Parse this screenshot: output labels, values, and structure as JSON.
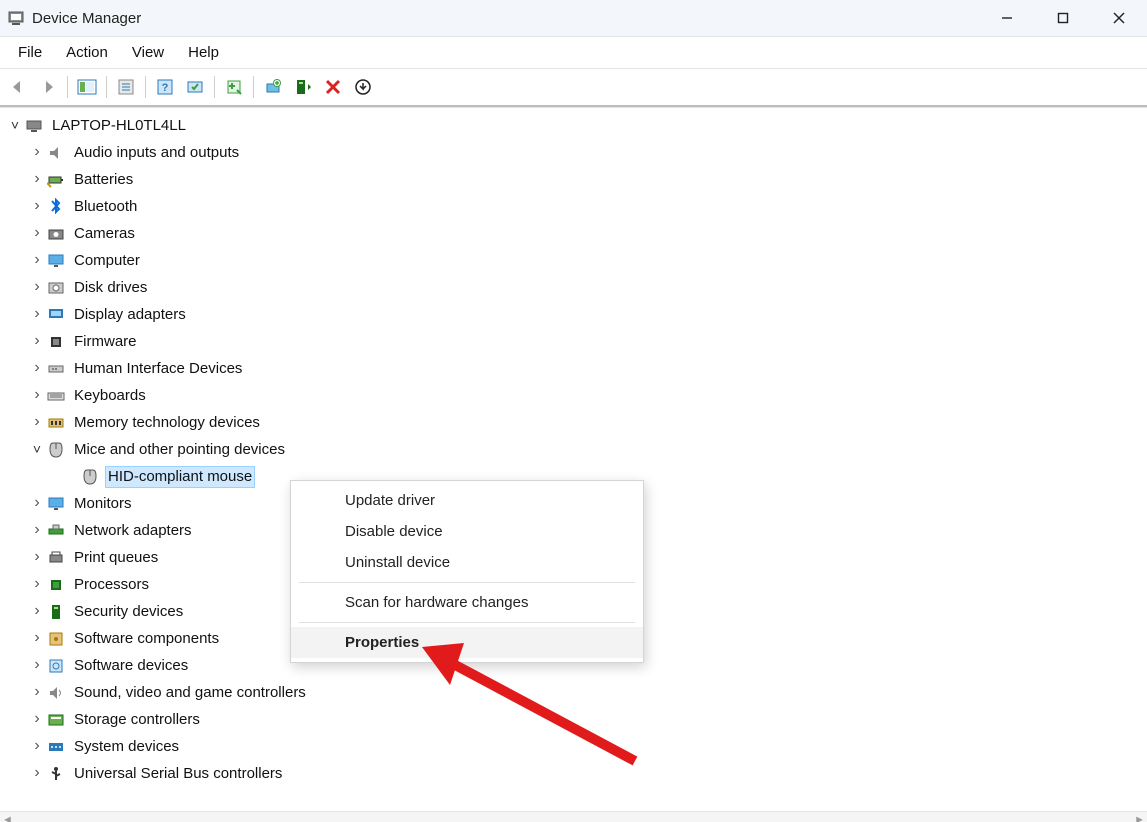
{
  "window": {
    "title": "Device Manager"
  },
  "menu": {
    "file": "File",
    "action": "Action",
    "view": "View",
    "help": "Help"
  },
  "toolbar_icons": {
    "back": "back-arrow",
    "forward": "forward-arrow",
    "show_hide": "show-hide-console-tree",
    "properties": "properties",
    "help": "help",
    "scan": "scan-for-hardware-changes",
    "add_legacy": "add-legacy-hardware",
    "update": "update-driver",
    "uninstall": "uninstall-device",
    "disable": "disable-device",
    "remove": "remove",
    "action2": "action"
  },
  "tree": {
    "root": "LAPTOP-HL0TL4LL",
    "categories": [
      {
        "label": "Audio inputs and outputs",
        "expanded": false,
        "icon": "speaker"
      },
      {
        "label": "Batteries",
        "expanded": false,
        "icon": "battery"
      },
      {
        "label": "Bluetooth",
        "expanded": false,
        "icon": "bluetooth"
      },
      {
        "label": "Cameras",
        "expanded": false,
        "icon": "camera"
      },
      {
        "label": "Computer",
        "expanded": false,
        "icon": "monitor"
      },
      {
        "label": "Disk drives",
        "expanded": false,
        "icon": "disk"
      },
      {
        "label": "Display adapters",
        "expanded": false,
        "icon": "display"
      },
      {
        "label": "Firmware",
        "expanded": false,
        "icon": "chip"
      },
      {
        "label": "Human Interface Devices",
        "expanded": false,
        "icon": "hid"
      },
      {
        "label": "Keyboards",
        "expanded": false,
        "icon": "keyboard"
      },
      {
        "label": "Memory technology devices",
        "expanded": false,
        "icon": "memory"
      },
      {
        "label": "Mice and other pointing devices",
        "expanded": true,
        "icon": "mouse",
        "children": [
          {
            "label": "HID-compliant mouse",
            "selected": true,
            "icon": "mouse"
          }
        ]
      },
      {
        "label": "Monitors",
        "expanded": false,
        "icon": "monitor-item"
      },
      {
        "label": "Network adapters",
        "expanded": false,
        "icon": "network"
      },
      {
        "label": "Print queues",
        "expanded": false,
        "icon": "printer"
      },
      {
        "label": "Processors",
        "expanded": false,
        "icon": "cpu"
      },
      {
        "label": "Security devices",
        "expanded": false,
        "icon": "security"
      },
      {
        "label": "Software components",
        "expanded": false,
        "icon": "component"
      },
      {
        "label": "Software devices",
        "expanded": false,
        "icon": "software"
      },
      {
        "label": "Sound, video and game controllers",
        "expanded": false,
        "icon": "sound"
      },
      {
        "label": "Storage controllers",
        "expanded": false,
        "icon": "storage"
      },
      {
        "label": "System devices",
        "expanded": false,
        "icon": "system"
      },
      {
        "label": "Universal Serial Bus controllers",
        "expanded": false,
        "icon": "usb"
      }
    ]
  },
  "context_menu": {
    "update_driver": "Update driver",
    "disable_device": "Disable device",
    "uninstall_device": "Uninstall device",
    "scan": "Scan for hardware changes",
    "properties": "Properties"
  }
}
